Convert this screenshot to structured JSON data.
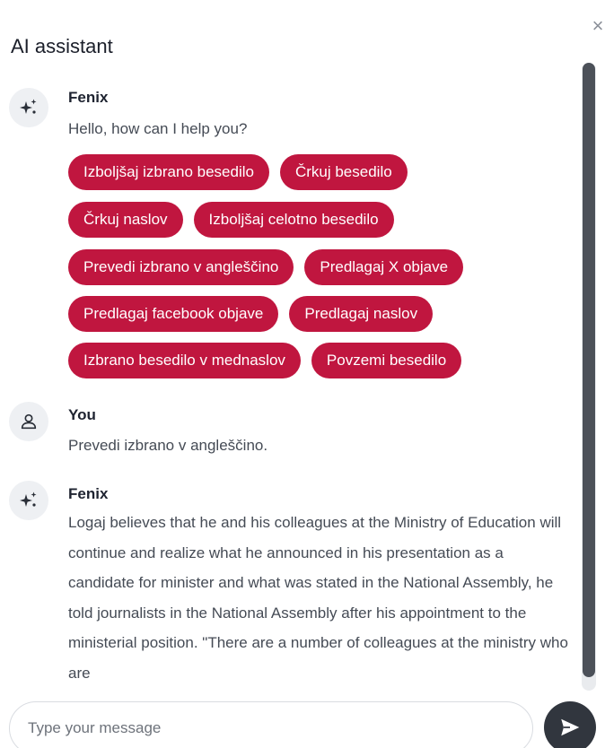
{
  "header": {
    "title": "AI assistant",
    "close_symbol": "×"
  },
  "messages": [
    {
      "author": "Fenix",
      "avatar_icon": "sparkle-icon",
      "text": "Hello, how can I help you?",
      "quick_actions": [
        [
          "Izboljšaj izbrano besedilo",
          "Črkuj besedilo"
        ],
        [
          "Črkuj naslov",
          "Izboljšaj celotno besedilo"
        ],
        [
          "Prevedi izbrano v angleščino",
          "Predlagaj X objave"
        ],
        [
          "Predlagaj facebook objave",
          "Predlagaj naslov"
        ],
        [
          "Izbrano besedilo v mednaslov",
          "Povzemi besedilo"
        ]
      ]
    },
    {
      "author": "You",
      "avatar_icon": "user-icon",
      "text": "Prevedi izbrano v angleščino."
    },
    {
      "author": "Fenix",
      "avatar_icon": "sparkle-icon",
      "text": "Logaj believes that he and his colleagues at the Ministry of Education will continue and realize what he announced in his presentation as a candidate for minister and what was stated in the National Assembly, he told journalists in the National Assembly after his appointment to the ministerial position. \"There are a number of colleagues at the ministry who are"
    }
  ],
  "composer": {
    "placeholder": "Type your message",
    "value": "",
    "send_icon": "send-icon"
  },
  "colors": {
    "chip_background": "#c0163f",
    "send_button": "#31363e",
    "scrollbar_thumb": "#4c5159"
  }
}
